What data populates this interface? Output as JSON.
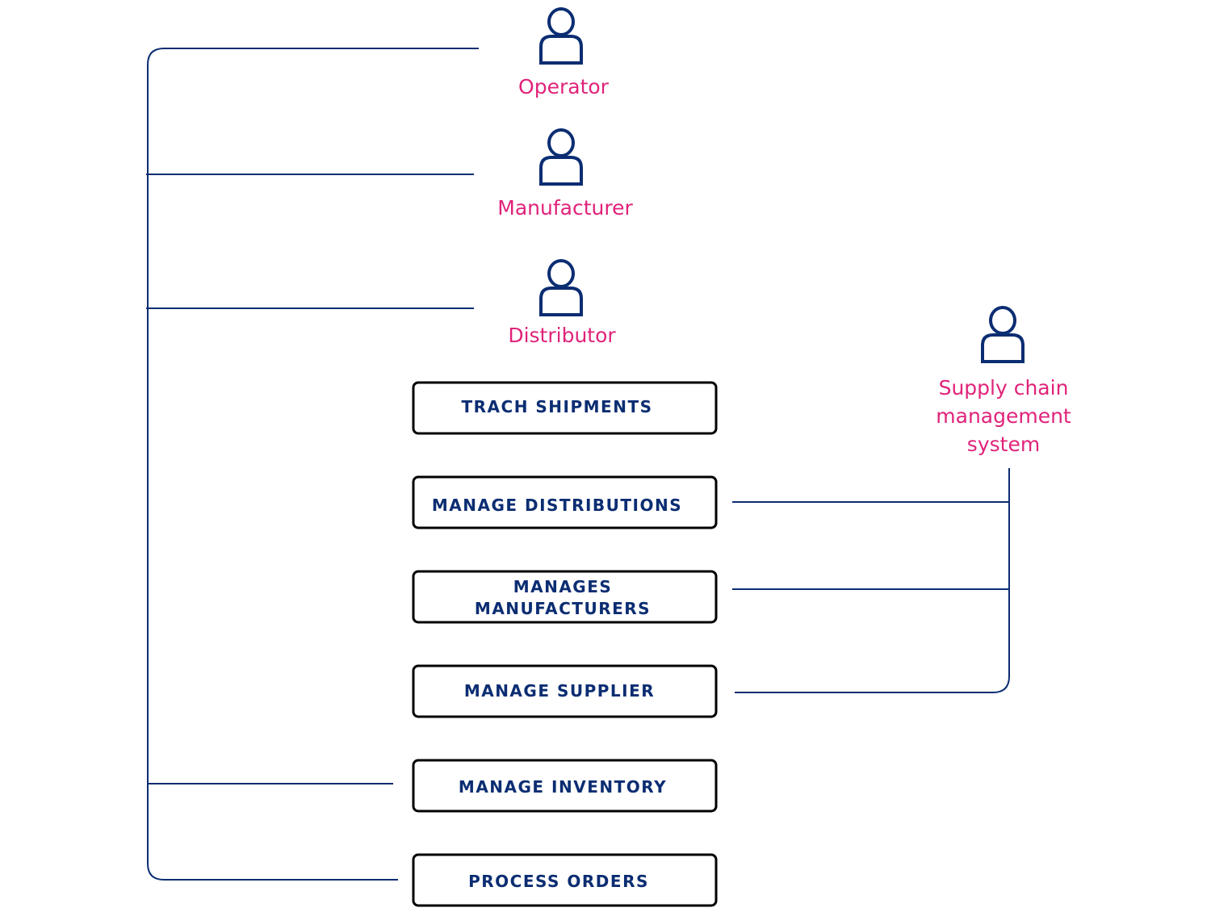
{
  "colors": {
    "connector": "#0b2d72",
    "actor_label": "#e0237a",
    "box_border": "#000000",
    "box_text": "#0b2d72"
  },
  "actors": [
    {
      "label": "Operator",
      "icon": "user-icon"
    },
    {
      "label": "Manufacturer",
      "icon": "user-icon"
    },
    {
      "label": "Distributor",
      "icon": "user-icon"
    },
    {
      "label_lines": [
        "Supply chain",
        "management",
        "system"
      ],
      "icon": "user-icon"
    }
  ],
  "use_cases": [
    {
      "lines": [
        "TRACH SHIPMENTS"
      ]
    },
    {
      "lines": [
        "MANAGE DISTRIBUTIONS"
      ]
    },
    {
      "lines": [
        "MANAGES",
        "MANUFACTURERS"
      ]
    },
    {
      "lines": [
        "MANAGE SUPPLIER"
      ]
    },
    {
      "lines": [
        "MANAGE INVENTORY"
      ]
    },
    {
      "lines": [
        "PROCESS ORDERS"
      ]
    }
  ]
}
